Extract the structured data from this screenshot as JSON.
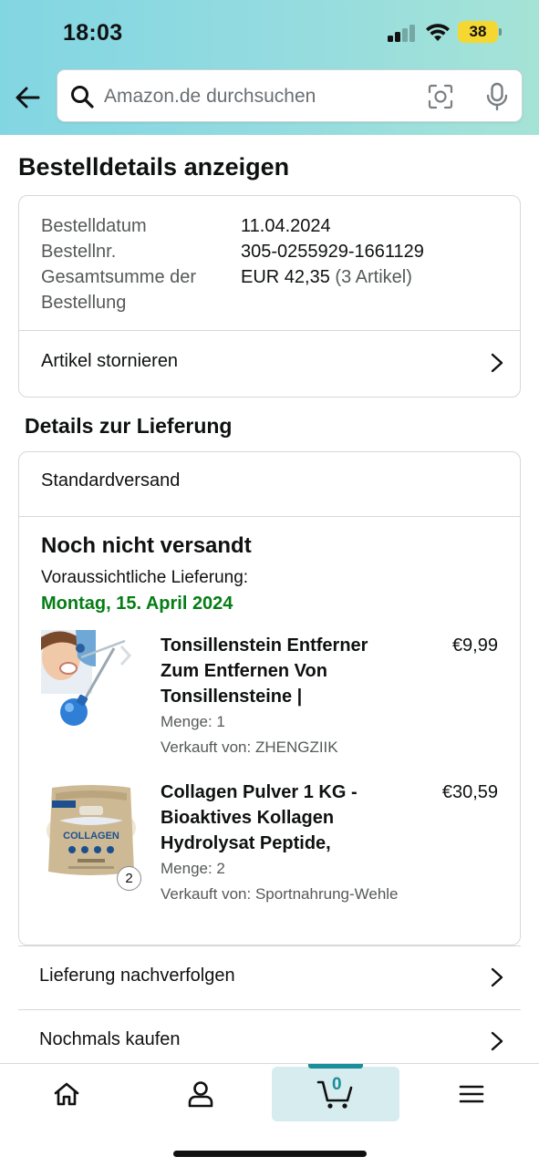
{
  "status_bar": {
    "time": "18:03",
    "battery": "38"
  },
  "search": {
    "placeholder": "Amazon.de durchsuchen"
  },
  "page_title": "Bestelldetails anzeigen",
  "order": {
    "date_label": "Bestelldatum",
    "date_value": "11.04.2024",
    "number_label": "Bestellnr.",
    "number_value": "305-0255929-1661129",
    "total_label_line1": "Gesamtsumme der",
    "total_label_line2": "Bestellung",
    "total_value": "EUR 42,35",
    "total_items": "(3 Artikel)",
    "cancel_label": "Artikel stornieren"
  },
  "delivery": {
    "section_title": "Details zur Lieferung",
    "method": "Standardversand",
    "status": "Noch nicht versandt",
    "eta_label": "Voraussichtliche Lieferung:",
    "eta_date": "Montag, 15. April 2024",
    "items": [
      {
        "title_lines": [
          "Tonsillenstein Entferner",
          "Zum Entfernen Von",
          "Tonsillensteine |"
        ],
        "price": "€9,99",
        "quantity": "Menge: 1",
        "seller": "Verkauft von: ZHENGZIIK",
        "image_icon": "tonsil-stone-remover-image"
      },
      {
        "title_lines": [
          "Collagen Pulver 1 KG -",
          "Bioaktives Kollagen",
          "Hydrolysat Peptide,"
        ],
        "price": "€30,59",
        "quantity": "Menge: 2",
        "seller": "Verkauft von: Sportnahrung-Wehle",
        "qty_badge": "2",
        "image_text": "COLLAGEN",
        "image_icon": "collagen-pouch-image"
      }
    ]
  },
  "actions": {
    "track_label": "Lieferung nachverfolgen",
    "buy_again_label": "Nochmals kaufen"
  },
  "bottom_nav": {
    "cart_count": "0",
    "items": [
      "home-icon",
      "account-icon",
      "cart-icon",
      "menu-icon"
    ]
  },
  "colors": {
    "header_gradient_start": "#82d6e2",
    "header_gradient_end": "#a5e3d6",
    "eta_green": "#067d15",
    "cart_teal": "#1a8e9a",
    "battery_yellow": "#f5d732"
  }
}
